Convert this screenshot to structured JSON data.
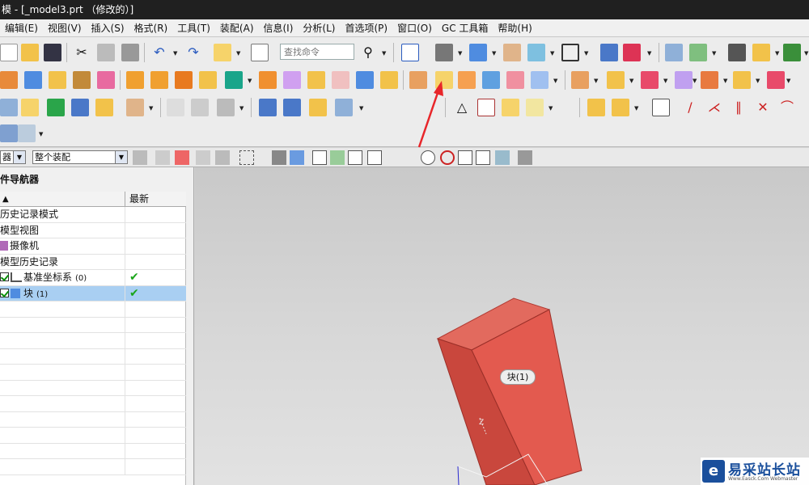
{
  "window": {
    "title": "模 - [_model3.prt （修改的）]"
  },
  "menu": {
    "items": [
      "编辑(E)",
      "视图(V)",
      "插入(S)",
      "格式(R)",
      "工具(T)",
      "装配(A)",
      "信息(I)",
      "分析(L)",
      "首选项(P)",
      "窗口(O)",
      "GC 工具箱",
      "帮助(H)"
    ]
  },
  "toolbar": {
    "search_placeholder": "查找命令"
  },
  "selection_bar": {
    "filter_value": "器",
    "scope_value": "整个装配"
  },
  "navigator": {
    "title": "件导航器",
    "column_name": "▲",
    "column_latest": "最新",
    "rows": [
      {
        "label": "历史记录模式",
        "count": "",
        "latest": ""
      },
      {
        "label": "模型视图",
        "count": "",
        "latest": ""
      },
      {
        "label": "摄像机",
        "count": "",
        "latest": ""
      },
      {
        "label": "模型历史记录",
        "count": "",
        "latest": ""
      },
      {
        "label": "基准坐标系",
        "count": "(0)",
        "latest": "✔"
      },
      {
        "label": "块",
        "count": "(1)",
        "latest": "✔"
      }
    ]
  },
  "viewport": {
    "block_label": "块(1)",
    "axis_label": "Z"
  },
  "watermark": {
    "text": "易采站长站",
    "sub": "Www.Easck.Com  Webmaster"
  },
  "colors": {
    "block_fill": "#d9554a",
    "selected_row": "#a9cff2",
    "check_green": "#1aa51a",
    "arrow_red": "#e8262a"
  }
}
